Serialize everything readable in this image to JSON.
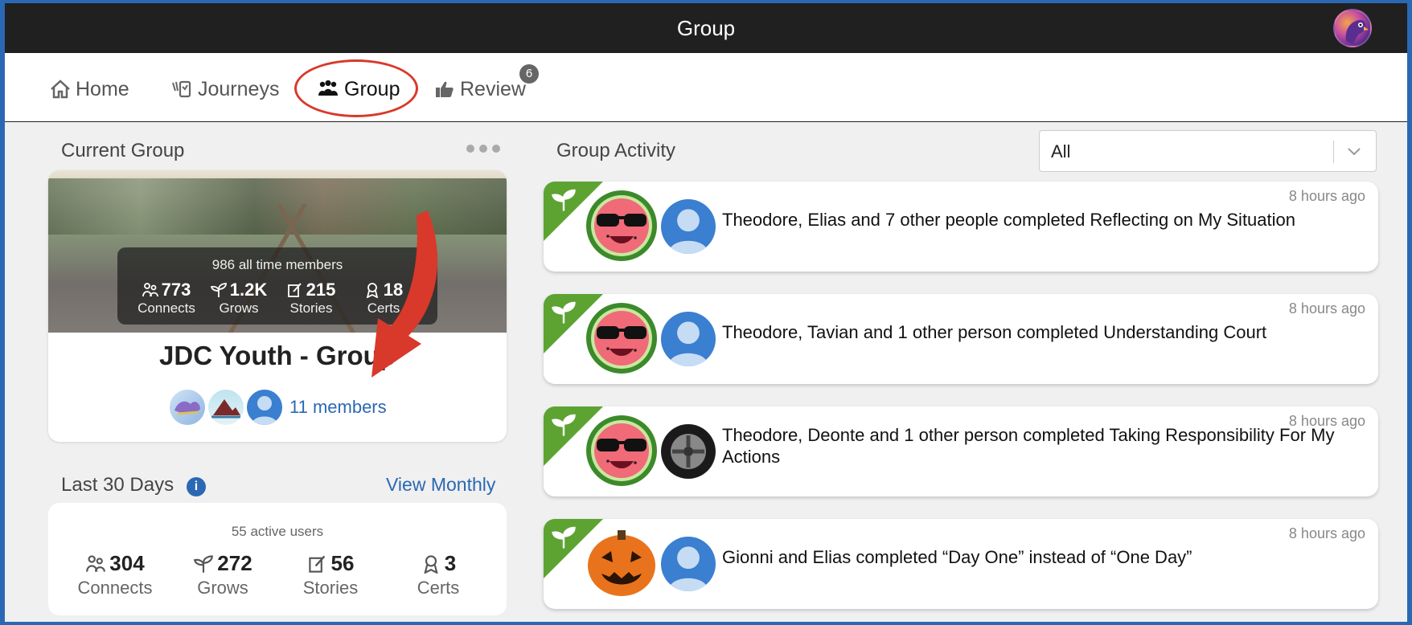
{
  "topbar": {
    "title": "Group"
  },
  "nav": {
    "items": [
      {
        "label": "Home"
      },
      {
        "label": "Journeys"
      },
      {
        "label": "Group"
      },
      {
        "label": "Review"
      }
    ],
    "review_badge": "6"
  },
  "current_group": {
    "heading": "Current Group",
    "all_time_members": "986 all time members",
    "stats": [
      {
        "value": "773",
        "label": "Connects"
      },
      {
        "value": "1.2K",
        "label": "Grows"
      },
      {
        "value": "215",
        "label": "Stories"
      },
      {
        "value": "18",
        "label": "Certs"
      }
    ],
    "name": "JDC Youth - Group",
    "members_link": "11 members"
  },
  "last30": {
    "heading": "Last 30 Days",
    "view_monthly": "View Monthly",
    "active_users": "55 active users",
    "stats": [
      {
        "value": "304",
        "label": "Connects"
      },
      {
        "value": "272",
        "label": "Grows"
      },
      {
        "value": "56",
        "label": "Stories"
      },
      {
        "value": "3",
        "label": "Certs"
      }
    ]
  },
  "activity": {
    "heading": "Group Activity",
    "filter_value": "All",
    "items": [
      {
        "time": "8 hours ago",
        "text": "Theodore, Elias and 7 other people completed Reflecting on My Situation"
      },
      {
        "time": "8 hours ago",
        "text": "Theodore, Tavian and 1 other person completed Understanding Court"
      },
      {
        "time": "8 hours ago",
        "text": "Theodore, Deonte and 1 other person completed Taking Responsibility For My Actions"
      },
      {
        "time": "8 hours ago",
        "text": "Gionni and Elias completed “Day One” instead of “One Day”"
      }
    ]
  },
  "colors": {
    "accent": "#2b68b3",
    "activity_corner": "#5ca332",
    "highlight": "#d8392b"
  }
}
